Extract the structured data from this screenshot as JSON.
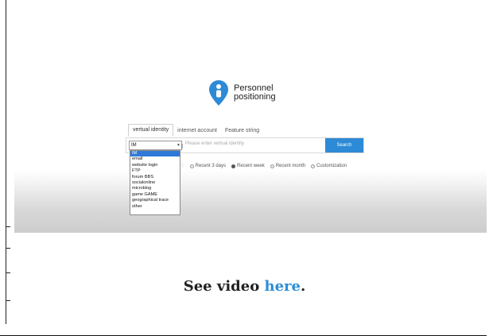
{
  "brand": {
    "line1": "Personnel",
    "line2": "positioning",
    "icon": "location-pin-person-icon",
    "color": "#2d8ad6"
  },
  "tabs": [
    {
      "label": "vertual identity",
      "active": true
    },
    {
      "label": "internet account",
      "active": false
    },
    {
      "label": "Feature string",
      "active": false
    }
  ],
  "search": {
    "selected_type": "IM",
    "placeholder": "Please enter vertual identity",
    "button_label": "Search"
  },
  "dropdown": {
    "options": [
      "IM",
      "email",
      "website login",
      "FTP",
      "forum BBS",
      "socialonline",
      "microblog",
      "game GAME",
      "geographical trace",
      "other"
    ],
    "selected_index": 0
  },
  "time_filter": {
    "prefix": ":",
    "options": [
      {
        "label": "Recent 3 days",
        "checked": false
      },
      {
        "label": "Recent week",
        "checked": true
      },
      {
        "label": "Recent month",
        "checked": false
      },
      {
        "label": "Customization",
        "checked": false
      }
    ]
  },
  "caption": {
    "prefix": "See video ",
    "link": "here",
    "suffix": "."
  }
}
